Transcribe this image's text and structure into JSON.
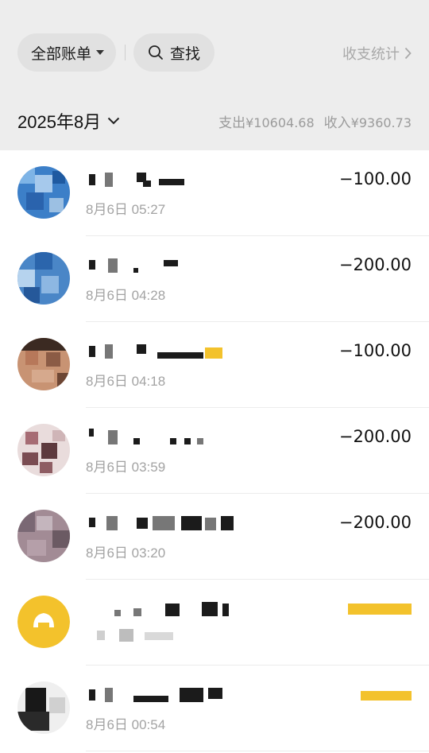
{
  "header": {
    "filter_label": "全部账单",
    "search_label": "查找",
    "stats_label": "收支统计"
  },
  "month_bar": {
    "month_label": "2025年8月",
    "expense_label": "支出",
    "expense_amount": "¥10604.68",
    "income_label": "收入",
    "income_amount": "¥9360.73"
  },
  "transactions": [
    {
      "time": "8月6日 05:27",
      "amount": "−100.00"
    },
    {
      "time": "8月6日 04:28",
      "amount": "−200.00"
    },
    {
      "time": "8月6日 04:18",
      "amount": "−100.00"
    },
    {
      "time": "8月6日 03:59",
      "amount": "−200.00"
    },
    {
      "time": "8月6日 03:20",
      "amount": "−200.00"
    },
    {
      "time": "",
      "amount": ""
    },
    {
      "time": "8月6日 00:54",
      "amount": ""
    }
  ],
  "colors": {
    "background_header": "#ededed",
    "pill": "#e1e1e1",
    "muted_text": "#a3a3a3",
    "accent_yellow": "#f3c22c"
  },
  "icons": [
    "chevron-down-icon",
    "search-icon",
    "chevron-right-icon",
    "wechat-pay-icon"
  ]
}
